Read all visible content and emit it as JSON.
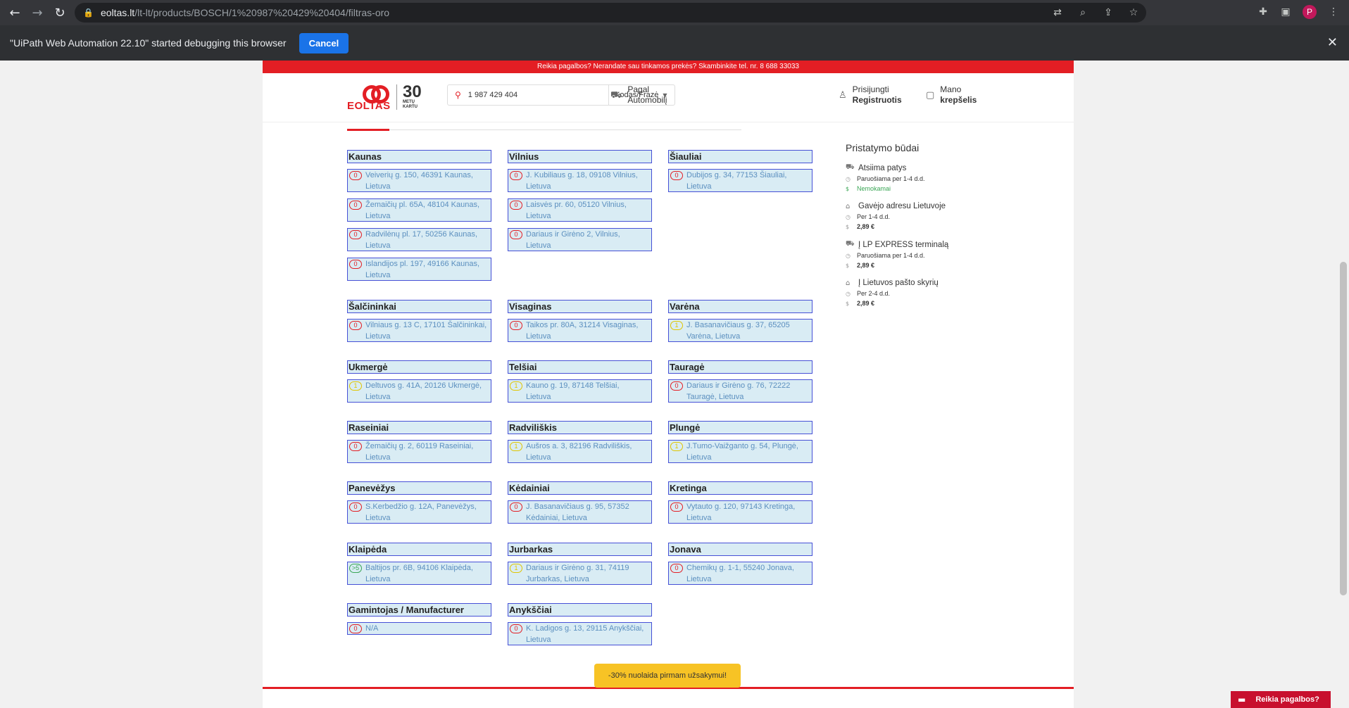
{
  "browser": {
    "url_host": "eoltas.lt",
    "url_path": "/lt-lt/products/BOSCH/1%20987%20429%20404/filtras-oro",
    "profile_initial": "P"
  },
  "debug_bar": {
    "message": "\"UiPath Web Automation 22.10\" started debugging this browser",
    "cancel_label": "Cancel"
  },
  "topbar": {
    "text": "Reikia pagalbos? Nerandate sau tinkamos prekės? Skambinkite tel. nr. 8 688 33033"
  },
  "logo": {
    "word": "EOLTAS",
    "years": "30",
    "sub1": "METŲ",
    "sub2": "KARTU"
  },
  "search": {
    "value": "1 987 429 404",
    "mode": "Kodas/Frazė"
  },
  "header": {
    "car_line1": "Pagal",
    "car_line2": "Automobilį",
    "login_line1": "Prisijungti",
    "login_line2": "Registruotis",
    "cart_line1": "Mano",
    "cart_line2": "krepšelis"
  },
  "stores": [
    {
      "city": "Kaunas",
      "items": [
        {
          "badge": "0",
          "line1": "Veiverių g. 150, 46391 Kaunas,",
          "line2": "Lietuva"
        },
        {
          "badge": "0",
          "line1": "Žemaičių pl. 65A, 48104 Kaunas,",
          "line2": "Lietuva"
        },
        {
          "badge": "0",
          "line1": "Radvilėnų pl. 17, 50256 Kaunas,",
          "line2": "Lietuva"
        },
        {
          "badge": "0",
          "line1": "Islandijos pl. 197, 49166 Kaunas,",
          "line2": "Lietuva"
        }
      ]
    },
    {
      "city": "Vilnius",
      "items": [
        {
          "badge": "0",
          "line1": "J. Kubiliaus g. 18, 09108 Vilnius,",
          "line2": "Lietuva"
        },
        {
          "badge": "0",
          "line1": "Laisvės pr. 60, 05120 Vilnius,",
          "line2": "Lietuva"
        },
        {
          "badge": "0",
          "line1": "Dariaus ir Girėno 2, Vilnius,",
          "line2": "Lietuva"
        }
      ]
    },
    {
      "city": "Šiauliai",
      "items": [
        {
          "badge": "0",
          "line1": "Dubijos g. 34, 77153 Šiauliai,",
          "line2": "Lietuva"
        }
      ]
    },
    {
      "city": "Šalčininkai",
      "items": [
        {
          "badge": "0",
          "line1": "Vilniaus g. 13 C, 17101 Šalčininkai,",
          "line2": "Lietuva"
        }
      ]
    },
    {
      "city": "Visaginas",
      "items": [
        {
          "badge": "0",
          "line1": "Taikos pr. 80A, 31214 Visaginas,",
          "line2": "Lietuva"
        }
      ]
    },
    {
      "city": "Varėna",
      "items": [
        {
          "badge": "1",
          "line1": "J. Basanavičiaus g. 37, 65205",
          "line2": "Varėna, Lietuva"
        }
      ]
    },
    {
      "city": "Ukmergė",
      "items": [
        {
          "badge": "1",
          "line1": "Deltuvos g. 41A, 20126 Ukmergė,",
          "line2": "Lietuva"
        }
      ]
    },
    {
      "city": "Telšiai",
      "items": [
        {
          "badge": "1",
          "line1": "Kauno g. 19, 87148 Telšiai,",
          "line2": "Lietuva"
        }
      ]
    },
    {
      "city": "Tauragė",
      "items": [
        {
          "badge": "0",
          "line1": "Dariaus ir Girėno g. 76, 72222",
          "line2": "Tauragė, Lietuva"
        }
      ]
    },
    {
      "city": "Raseiniai",
      "items": [
        {
          "badge": "0",
          "line1": "Žemaičių g. 2, 60119 Raseiniai,",
          "line2": "Lietuva"
        }
      ]
    },
    {
      "city": "Radviliškis",
      "items": [
        {
          "badge": "1",
          "line1": "Aušros a. 3, 82196 Radviliškis,",
          "line2": "Lietuva"
        }
      ]
    },
    {
      "city": "Plungė",
      "items": [
        {
          "badge": "1",
          "line1": "J.Tumo-Vaižganto g. 54, Plungė,",
          "line2": "Lietuva"
        }
      ]
    },
    {
      "city": "Panevėžys",
      "items": [
        {
          "badge": "0",
          "line1": "S.Kerbedžio g. 12A, Panevėžys,",
          "line2": "Lietuva"
        }
      ]
    },
    {
      "city": "Kėdainiai",
      "items": [
        {
          "badge": "0",
          "line1": "J. Basanavičiaus g. 95, 57352",
          "line2": "Kėdainiai, Lietuva"
        }
      ]
    },
    {
      "city": "Kretinga",
      "items": [
        {
          "badge": "0",
          "line1": "Vytauto g. 120, 97143 Kretinga,",
          "line2": "Lietuva"
        }
      ]
    },
    {
      "city": "Klaipėda",
      "items": [
        {
          "badge": ">5",
          "line1": "Baltijos pr. 6B, 94106 Klaipėda,",
          "line2": "Lietuva"
        }
      ]
    },
    {
      "city": "Jurbarkas",
      "items": [
        {
          "badge": "1",
          "line1": "Dariaus ir Girėno g. 31, 74119",
          "line2": "Jurbarkas, Lietuva"
        }
      ]
    },
    {
      "city": "Jonava",
      "items": [
        {
          "badge": "0",
          "line1": "Chemikų g. 1-1, 55240 Jonava,",
          "line2": "Lietuva"
        }
      ]
    },
    {
      "city": "Gamintojas / Manufacturer",
      "items": [
        {
          "badge": "0",
          "line1": "N/A",
          "line2": ""
        }
      ]
    },
    {
      "city": "Anykščiai",
      "items": [
        {
          "badge": "0",
          "line1": "K. Ladigos g. 13, 29115 Anykščiai,",
          "line2": "Lietuva"
        }
      ]
    }
  ],
  "delivery": {
    "title": "Pristatymo būdai",
    "options": [
      {
        "name": "Atsiima patys",
        "time": "Paruošiama per 1-4 d.d.",
        "price": "Nemokamai",
        "icon": "truck-icon"
      },
      {
        "name": "Gavėjo adresu Lietuvoje",
        "time": "Per 1-4 d.d.",
        "price": "2,89 €",
        "icon": "home-icon"
      },
      {
        "name": "Į LP EXPRESS terminalą",
        "time": "Paruošiama per 1-4 d.d.",
        "price": "2,89 €",
        "icon": "truck-icon"
      },
      {
        "name": "Į Lietuvos pašto skyrių",
        "time": "Per 2-4 d.d.",
        "price": "2,89 €",
        "icon": "home-icon"
      }
    ]
  },
  "promo": {
    "text": "-30% nuolaida pirmam užsakymui!"
  },
  "help": {
    "label": "Reikia pagalbos?"
  },
  "colors": {
    "brand_red": "#e31e24",
    "store_bg": "#d9ecf4",
    "store_border": "#4650d6",
    "promo": "#f7c325"
  }
}
